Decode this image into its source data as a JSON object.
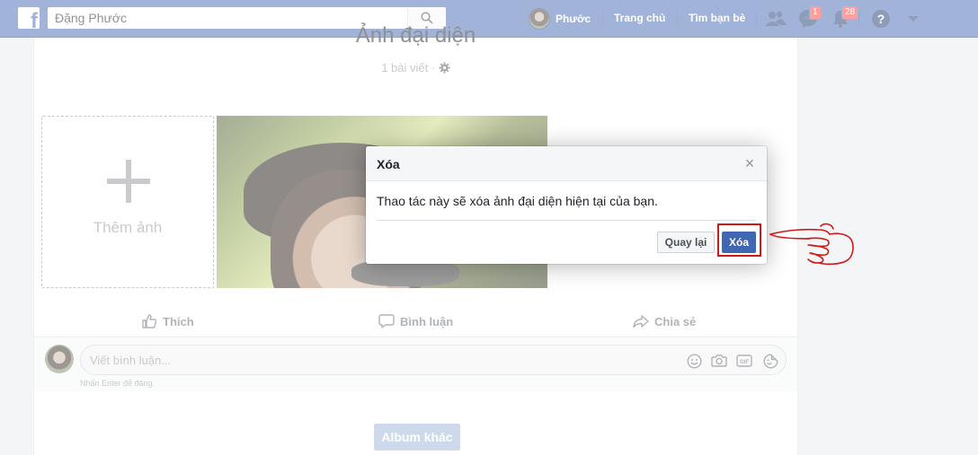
{
  "topbar": {
    "search_value": "Đặng Phước",
    "profile_name": "Phước",
    "home_label": "Trang chủ",
    "find_friends_label": "Tìm bạn bè",
    "messages_badge": "1",
    "notifications_badge": "28"
  },
  "album": {
    "title": "Ảnh đại diện",
    "post_count": "1 bài viết ·",
    "add_photo_label": "Thêm ảnh"
  },
  "actions": {
    "like": "Thích",
    "comment": "Bình luận",
    "share": "Chia sẻ"
  },
  "comment": {
    "placeholder": "Viết bình luận...",
    "enter_hint": "Nhấn Enter để đăng.",
    "gif_label": "GIF"
  },
  "other_album_label": "Album khác",
  "dialog": {
    "title": "Xóa",
    "message": "Thao tác này sẽ xóa ảnh đại diện hiện tại của bạn.",
    "cancel_label": "Quay lại",
    "confirm_label": "Xóa"
  },
  "colors": {
    "brand": "#4267b2",
    "badge": "#fa3e3e",
    "highlight": "#d01818"
  }
}
